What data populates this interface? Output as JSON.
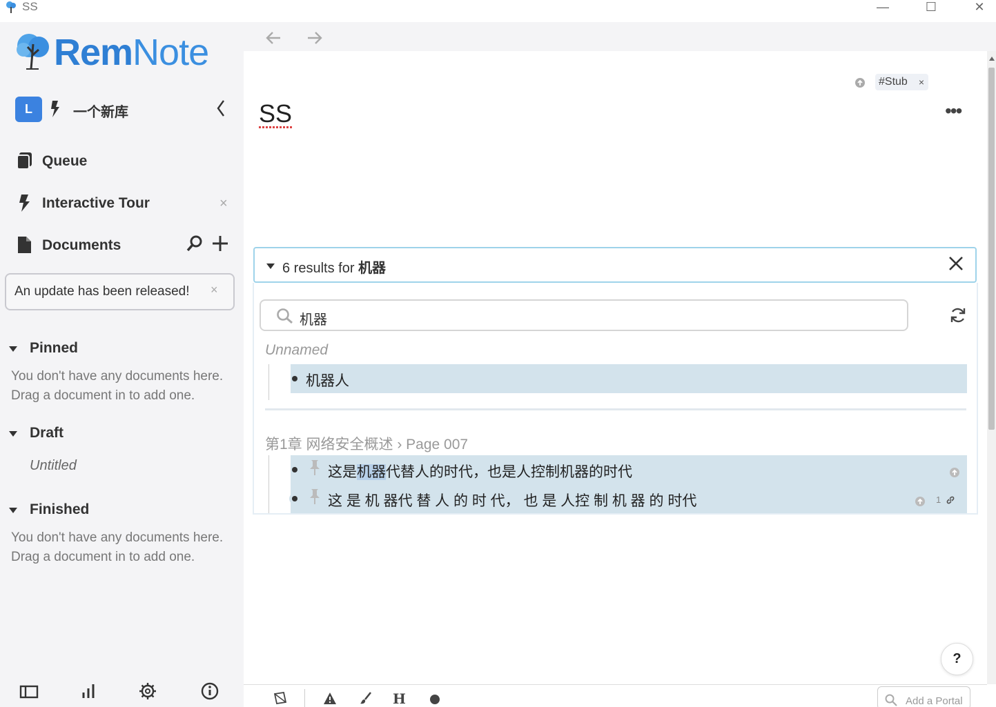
{
  "window": {
    "title": "SS",
    "minimize": "—",
    "maximize": "☐",
    "close": "✕"
  },
  "sidebar": {
    "logo_text_bold": "Rem",
    "logo_text": "Note",
    "kb": {
      "badge": "L",
      "name": "一个新库"
    },
    "nav": {
      "queue": "Queue",
      "tour": "Interactive Tour",
      "tour_close": "×",
      "documents": "Documents"
    },
    "update": {
      "text": "An update has been released!",
      "close": "×"
    },
    "sections": {
      "pinned": {
        "title": "Pinned",
        "empty_line1": "You don't have any documents here.",
        "empty_line2": "Drag a document in to add one."
      },
      "draft": {
        "title": "Draft",
        "doc": "Untitled"
      },
      "finished": {
        "title": "Finished",
        "empty_line1": "You don't have any documents here.",
        "empty_line2": "Drag a document in to add one."
      }
    }
  },
  "document": {
    "title": "SS",
    "tag": "#Stub",
    "tag_remove": "×",
    "more": "•••"
  },
  "search": {
    "results_prefix": "6 results for ",
    "results_query": "机器",
    "input_value": "机器",
    "groups": [
      {
        "title": "Unnamed",
        "rows": [
          {
            "text": "机器人"
          }
        ]
      },
      {
        "title": "第1章  网络安全概述 › Page 007",
        "rows": [
          {
            "text_before": "这是",
            "text_hl": "机器",
            "text_after": "代替人的时代，也是人控制机器的时代"
          },
          {
            "text": "这 是 机 器代 替 人 的 时 代， 也 是 人控 制 机 器 的 时代",
            "count": "1"
          }
        ]
      }
    ]
  },
  "help": "?",
  "toolbar": {
    "portal_placeholder": "Add a Portal"
  },
  "colors": {
    "brand": "#3b8fe0",
    "highlight_row": "#d3e3ec",
    "results_border": "#9ed3ea"
  }
}
